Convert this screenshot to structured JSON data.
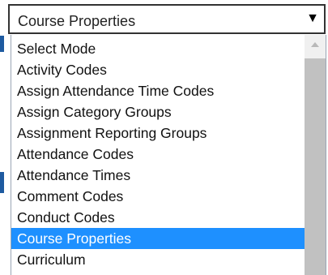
{
  "select": {
    "value": "Course Properties",
    "arrow_glyph": "▼"
  },
  "dropdown": {
    "items": [
      "Select Mode",
      "Activity Codes",
      "Assign Attendance Time Codes",
      "Assign Category Groups",
      "Assignment Reporting Groups",
      "Attendance Codes",
      "Attendance Times",
      "Comment Codes",
      "Conduct Codes",
      "Course Properties",
      "Curriculum"
    ],
    "selected": "Course Properties"
  },
  "colors": {
    "selection_background": "#1e90ff",
    "select_border": "#333333",
    "scrollbar_thumb": "#c1c1c1",
    "scrollbar_track": "#f0f0f0"
  },
  "icons": {
    "select_arrow": "chevron-down-icon",
    "scroll_up": "scroll-up-arrow-icon"
  }
}
